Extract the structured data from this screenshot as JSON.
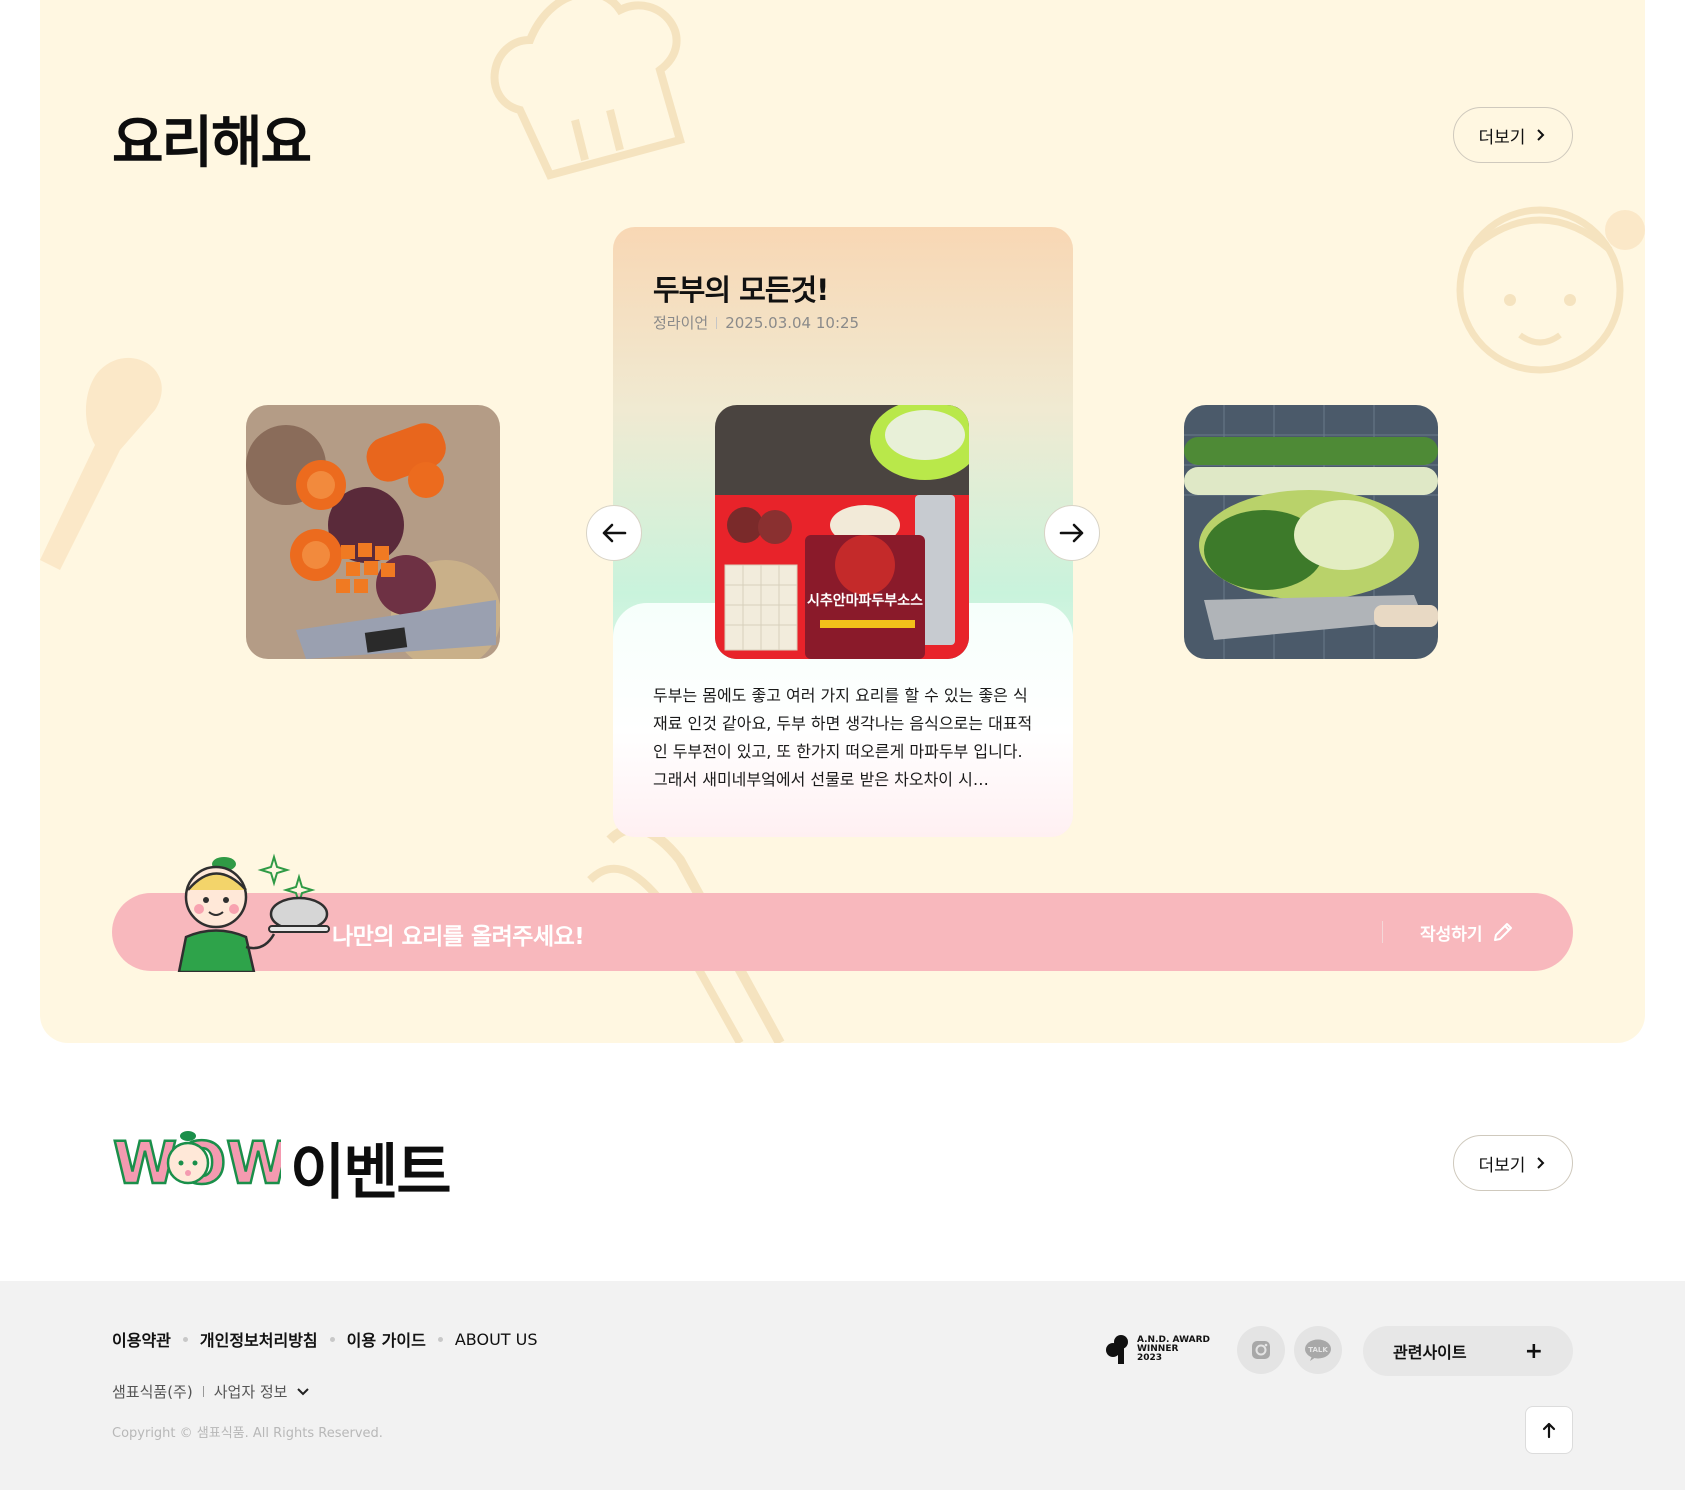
{
  "cooking": {
    "title": "요리해요",
    "more_label": "더보기",
    "card": {
      "title": "두부의 모든것!",
      "author": "정라이언",
      "date": "2025.03.04 10:25",
      "body": "두부는 몸에도 좋고 여러 가지 요리를 할 수 있는 좋은 식재료 인것 같아요, 두부 하면 생각나는 음식으로는 대표적인 두부전이 있고, 또 한가지 떠오른게 마파두부 입니다. 그래서 새미네부엌에서 선물로 받은 차오차이 시…",
      "package_text": "시추안마파두부소스"
    },
    "upload_banner": {
      "text": "나만의 요리를 올려주세요!",
      "write_label": "작성하기"
    }
  },
  "event": {
    "logo_text": "WOW!",
    "title": "이벤트",
    "more_label": "더보기"
  },
  "footer": {
    "links": [
      "이용약관",
      "개인정보처리방침",
      "이용 가이드",
      "ABOUT US"
    ],
    "company": "샘표식품(주)",
    "business_info_label": "사업자 정보",
    "copyright": "Copyright © 샘표식품. All Rights Reserved.",
    "award": {
      "line1": "A.N.D. AWARD",
      "line2": "WINNER",
      "line3": "2023"
    },
    "talk_label": "TALK",
    "related_sites_label": "관련사이트",
    "related_sites_icon": "plus-icon"
  },
  "colors": {
    "section_bg": "#fff7e1",
    "banner_pink": "#f8b8bd",
    "footer_bg": "#f2f2f2",
    "wow_green": "#1a8f4a",
    "wow_pink": "#f49ab0"
  }
}
